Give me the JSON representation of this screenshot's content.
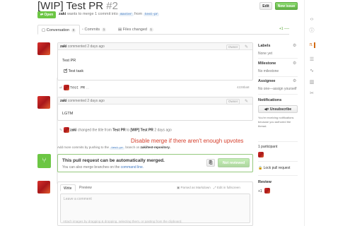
{
  "header": {
    "title": "[WIP] Test PR",
    "number": "#2",
    "edit_label": "Edit",
    "new_issue_label": "New issue",
    "state_label": "Open",
    "author": "zaki",
    "meta_mid": "wants to merge 1 commit into",
    "base_branch": "master",
    "meta_from": "from",
    "head_branch": "test-pr"
  },
  "tabs": [
    {
      "label": "Conversation",
      "count": "0",
      "icon": "comment-discussion-icon"
    },
    {
      "label": "Commits",
      "count": "1",
      "icon": "git-commit-icon"
    },
    {
      "label": "Files changed",
      "count": "1",
      "icon": "file-diff-icon"
    }
  ],
  "diffstat": "+1 ──",
  "comments": [
    {
      "author": "zaki",
      "time": "commented 2 days ago",
      "owner": "Owner",
      "body": "Test PR",
      "task": "Test task"
    },
    {
      "author": "zaki",
      "time": "commented 2 days ago",
      "owner": "Owner",
      "body": "LGTM"
    }
  ],
  "commit_event": {
    "message": "Test PR",
    "sha": "4228ba8"
  },
  "rename_event": {
    "author": "zaki",
    "text1": "changed the title from",
    "old_title": "Test PR",
    "text2": "to",
    "new_title": "[WIP] Test PR",
    "time": "2 days ago"
  },
  "push_hint": {
    "prefix": "Add more commits by pushing to the",
    "branch": "test-pr",
    "mid": "branch on",
    "repo": "zaki/test-repository."
  },
  "annotation": "Disable merge if there aren't enough upvotes",
  "merge": {
    "title": "This pull request can be automatically merged.",
    "subtitle_prefix": "You can also merge branches on the",
    "command_line": "command line.",
    "button_label": "Not reviewed"
  },
  "form": {
    "write_tab": "Write",
    "preview_tab": "Preview",
    "markdown_hint": "Parsed as Markdown",
    "fullscreen_hint": "Edit in fullscreen",
    "placeholder": "Leave a comment",
    "attach_hint": "Attach images by dragging & dropping, selecting them, or pasting from the clipboard."
  },
  "sidebar": {
    "labels_heading": "Labels",
    "labels_value": "None yet",
    "milestone_heading": "Milestone",
    "milestone_value": "No milestone",
    "assignee_heading": "Assignee",
    "assignee_value": "No one—assign yourself",
    "notifications_heading": "Notifications",
    "unsubscribe_label": "Unsubscribe",
    "notifications_text1": "You're receiving notifications",
    "notifications_text2": "because you authored the",
    "notifications_text3": "thread.",
    "participants_label": "1 participant",
    "lock_label": "Lock pull request",
    "review_heading": "Review",
    "review_count": "+1"
  },
  "colors": {
    "green": "#6cc644",
    "annotation": "#d53e2b",
    "link": "#4078c0"
  }
}
